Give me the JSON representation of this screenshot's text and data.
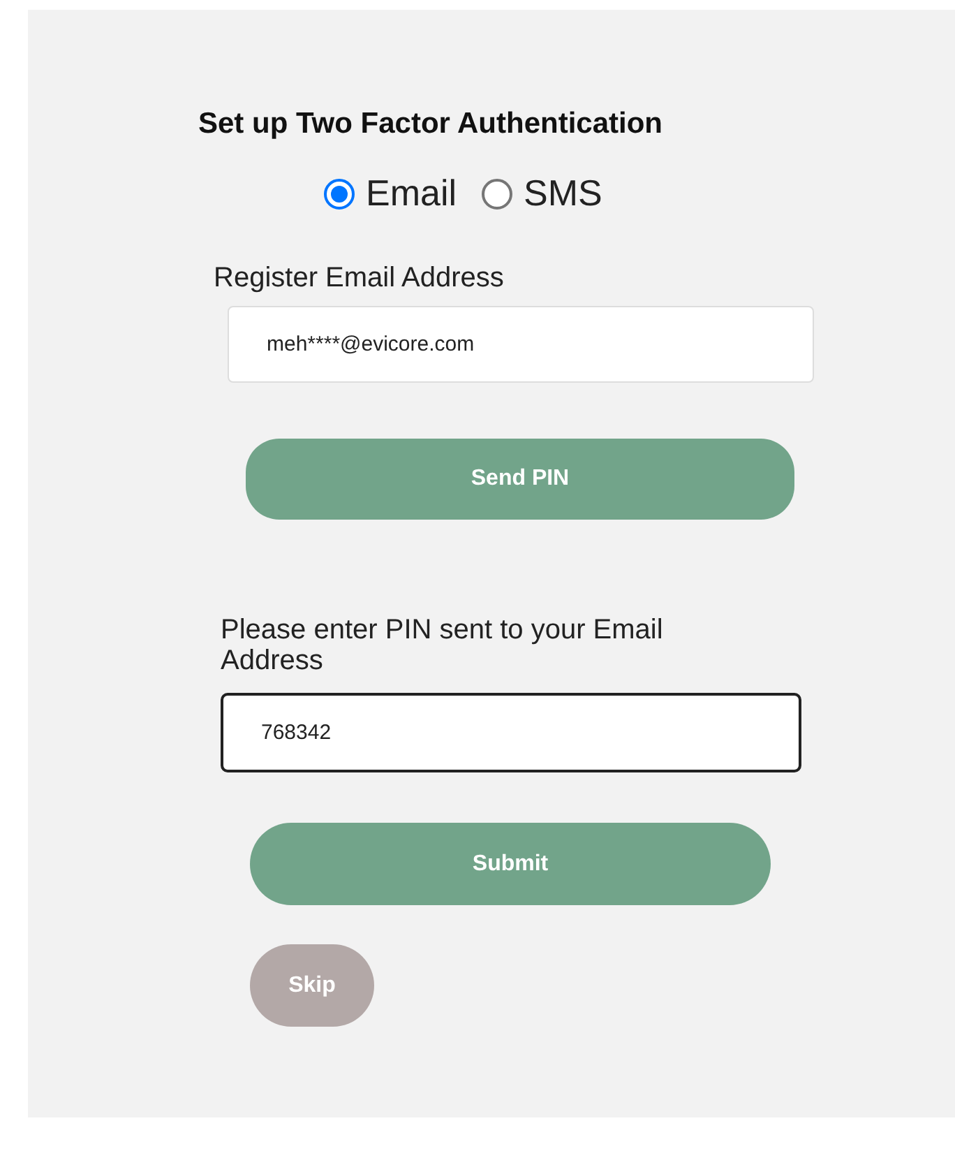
{
  "title": "Set up Two Factor Authentication",
  "methods": [
    {
      "label": "Email",
      "selected": true
    },
    {
      "label": "SMS",
      "selected": false
    }
  ],
  "email": {
    "label": "Register Email Address",
    "value": "meh****@evicore.com",
    "focused": false
  },
  "send_button": {
    "label": "Send PIN",
    "disabled": false
  },
  "pin": {
    "label": "Please enter PIN sent to your Email Address",
    "value": "768342",
    "focused": true
  },
  "submit_button": {
    "label": "Submit",
    "disabled": false
  },
  "skip_button": {
    "label": "Skip",
    "disabled": true
  }
}
